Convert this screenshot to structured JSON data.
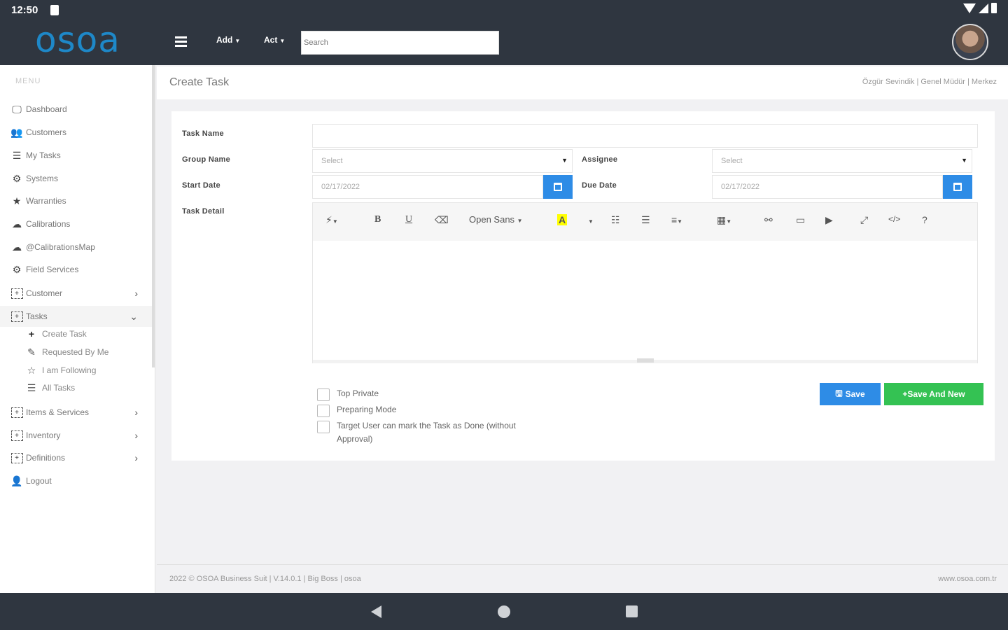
{
  "status": {
    "time": "12:50"
  },
  "header": {
    "logo": "osoa",
    "menu_add": "Add",
    "menu_act": "Act",
    "search_placeholder": "Search"
  },
  "sidebar": {
    "menu_label": "MENU",
    "items": [
      {
        "label": "Dashboard",
        "icon": "monitor-icon"
      },
      {
        "label": "Customers",
        "icon": "users-icon"
      },
      {
        "label": "My Tasks",
        "icon": "list-icon"
      },
      {
        "label": "Systems",
        "icon": "gear-icon"
      },
      {
        "label": "Warranties",
        "icon": "star-icon"
      },
      {
        "label": "Calibrations",
        "icon": "cloud-icon"
      },
      {
        "label": "@CalibrationsMap",
        "icon": "map-icon"
      },
      {
        "label": "Field Services",
        "icon": "cogs-icon"
      },
      {
        "label": "Customer",
        "icon": "plus-box-icon"
      },
      {
        "label": "Tasks",
        "icon": "plus-box-icon"
      },
      {
        "label": "Items & Services",
        "icon": "plus-box-icon"
      },
      {
        "label": "Inventory",
        "icon": "plus-box-icon"
      },
      {
        "label": "Definitions",
        "icon": "plus-box-icon"
      },
      {
        "label": "Logout",
        "icon": "user-icon"
      }
    ],
    "task_subitems": [
      {
        "label": "Create Task",
        "icon": "plus-icon"
      },
      {
        "label": "Requested By Me",
        "icon": "edit-icon"
      },
      {
        "label": "I am Following",
        "icon": "star-outline-icon"
      },
      {
        "label": "All Tasks",
        "icon": "list-icon"
      }
    ]
  },
  "page": {
    "title": "Create Task",
    "breadcrumb": "Özgür Sevindik | Genel Müdür | Merkez"
  },
  "form": {
    "task_name_label": "Task Name",
    "task_name_value": "",
    "group_name_label": "Group Name",
    "group_name_value": "Select",
    "assignee_label": "Assignee",
    "assignee_value": "Select",
    "start_date_label": "Start Date",
    "start_date_value": "02/17/2022",
    "due_date_label": "Due Date",
    "due_date_value": "02/17/2022",
    "task_detail_label": "Task Detail",
    "font_name": "Open Sans",
    "checkboxes": [
      {
        "label": "Top Private",
        "checked": false
      },
      {
        "label": "Preparing Mode",
        "checked": false
      },
      {
        "label": "Target User can mark the Task as Done (without",
        "label2": "Approval)",
        "checked": false
      }
    ],
    "save_label": "Save",
    "save_new_label": "+Save And New"
  },
  "footer": {
    "left": "2022 © OSOA Business Suit | V.14.0.1 | Big Boss | osoa",
    "right": "www.osoa.com.tr"
  },
  "colors": {
    "header_bg": "#2f3640",
    "logo": "#1e88c8",
    "primary": "#2e8ce6",
    "success": "#34c253"
  }
}
